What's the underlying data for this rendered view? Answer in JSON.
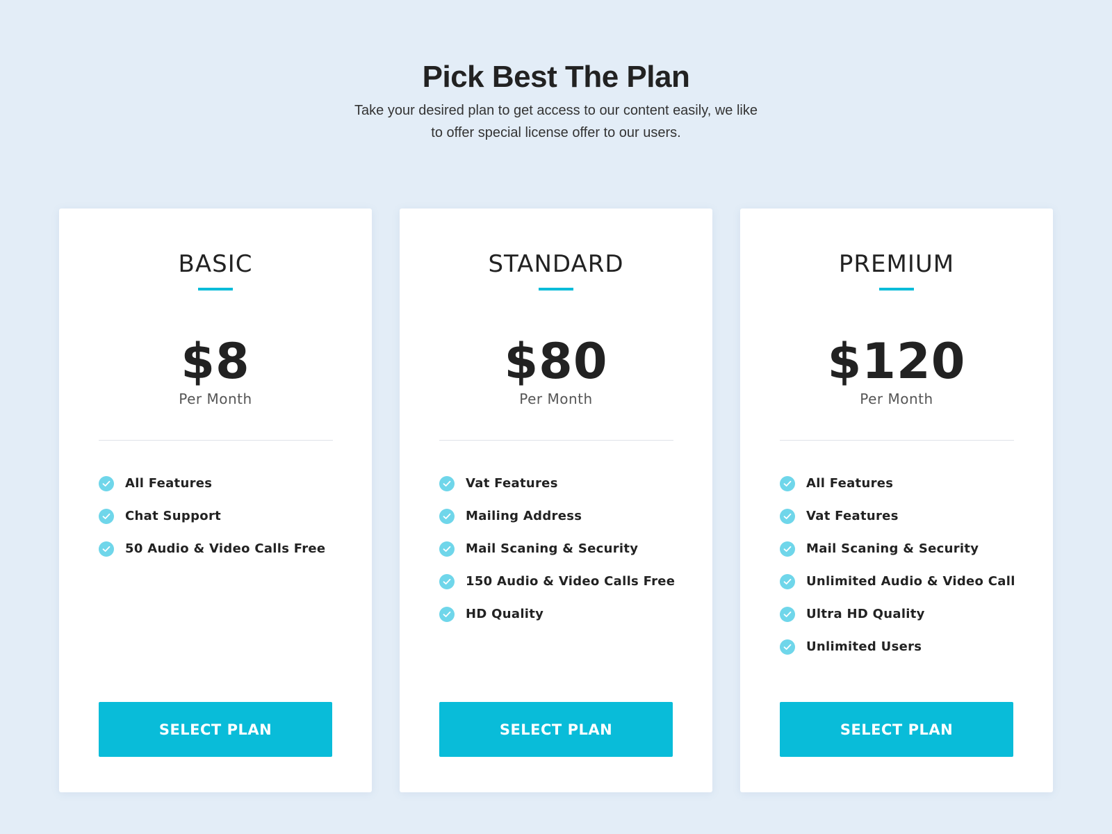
{
  "header": {
    "title": "Pick Best The Plan",
    "subtitle": "Take your desired plan to get access to our content easily, we like to offer special license offer to our users."
  },
  "colors": {
    "accent": "#09bcd9",
    "check": "#6fd6ea",
    "background": "#e3edf7"
  },
  "plans": [
    {
      "name": "BASIC",
      "price": "$8",
      "period": "Per Month",
      "features": [
        "All Features",
        "Chat Support",
        "50 Audio & Video Calls Free"
      ],
      "button_label": "SELECT PLAN"
    },
    {
      "name": "STANDARD",
      "price": "$80",
      "period": "Per Month",
      "features": [
        "Vat Features",
        "Mailing Address",
        "Mail Scaning & Security",
        "150 Audio & Video Calls Free",
        "HD Quality"
      ],
      "button_label": "SELECT PLAN"
    },
    {
      "name": "PREMIUM",
      "price": "$120",
      "period": "Per Month",
      "features": [
        "All Features",
        "Vat Features",
        "Mail Scaning & Security",
        "Unlimited Audio & Video Call",
        "Ultra HD Quality",
        "Unlimited Users"
      ],
      "button_label": "SELECT PLAN"
    }
  ]
}
